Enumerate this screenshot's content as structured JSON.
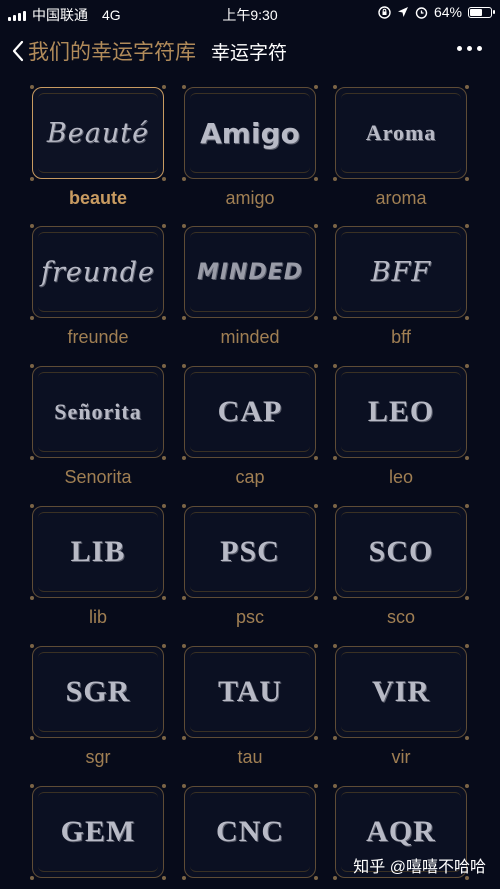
{
  "status_bar": {
    "carrier": "中国联通",
    "network": "4G",
    "time": "上午9:30",
    "battery_percent": "64%",
    "battery_level": 0.64
  },
  "nav": {
    "back_label": "我们的幸运字符库",
    "title": "幸运字符"
  },
  "cards": [
    {
      "logo": "Beauté",
      "label": "beaute",
      "style": "script",
      "selected": true
    },
    {
      "logo": "Amigo",
      "label": "amigo",
      "style": "bold",
      "selected": false
    },
    {
      "logo": "Aroma",
      "label": "aroma",
      "style": "serif-small",
      "selected": false
    },
    {
      "logo": "freunde",
      "label": "freunde",
      "style": "script",
      "selected": false
    },
    {
      "logo": "MINDED",
      "label": "minded",
      "style": "blocky",
      "selected": false
    },
    {
      "logo": "BFF",
      "label": "bff",
      "style": "script",
      "selected": false
    },
    {
      "logo": "Señorita",
      "label": "Senorita",
      "style": "serif-small",
      "selected": false
    },
    {
      "logo": "CAP",
      "label": "cap",
      "style": "serif",
      "selected": false
    },
    {
      "logo": "LEO",
      "label": "leo",
      "style": "serif",
      "selected": false
    },
    {
      "logo": "LIB",
      "label": "lib",
      "style": "serif",
      "selected": false
    },
    {
      "logo": "PSC",
      "label": "psc",
      "style": "serif",
      "selected": false
    },
    {
      "logo": "SCO",
      "label": "sco",
      "style": "serif",
      "selected": false
    },
    {
      "logo": "SGR",
      "label": "sgr",
      "style": "serif",
      "selected": false
    },
    {
      "logo": "TAU",
      "label": "tau",
      "style": "serif",
      "selected": false
    },
    {
      "logo": "VIR",
      "label": "vir",
      "style": "serif",
      "selected": false
    },
    {
      "logo": "GEM",
      "label": "",
      "style": "serif",
      "selected": false
    },
    {
      "logo": "CNC",
      "label": "",
      "style": "serif",
      "selected": false
    },
    {
      "logo": "AQR",
      "label": "",
      "style": "serif",
      "selected": false
    }
  ],
  "watermark": "知乎 @嘻嘻不哈哈",
  "colors": {
    "background": "#070b1a",
    "accent_gold": "#c89b61",
    "label_gold": "#a07f53",
    "logo_gray": "#b8bac6"
  }
}
